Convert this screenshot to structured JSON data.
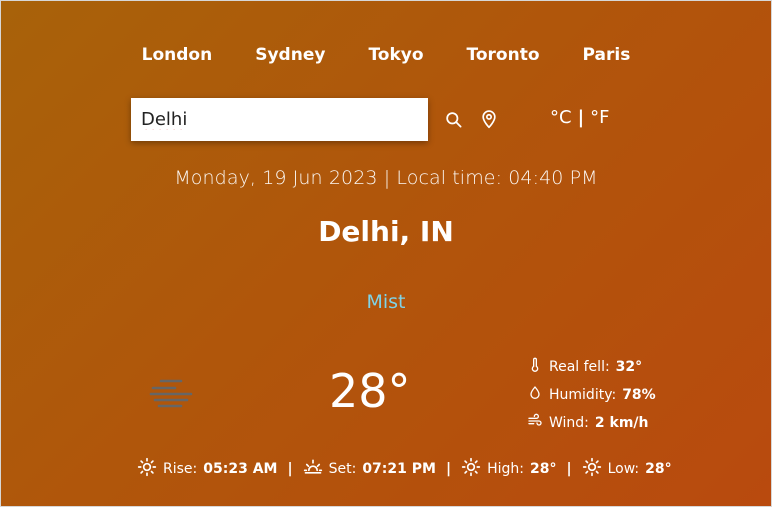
{
  "cities": [
    "London",
    "Sydney",
    "Tokyo",
    "Toronto",
    "Paris"
  ],
  "search": {
    "value": "Delhi"
  },
  "units": {
    "celsius": "°C",
    "separator": "|",
    "fahrenheit": "°F"
  },
  "datetime": "Monday, 19 Jun 2023 | Local time: 04:40 PM",
  "location": "Delhi, IN",
  "condition": "Mist",
  "temperature": "28°",
  "details": {
    "real_feel_label": "Real fell:",
    "real_feel_value": "32°",
    "humidity_label": "Humidity:",
    "humidity_value": "78%",
    "wind_label": "Wind:",
    "wind_value": "2 km/h"
  },
  "sun": {
    "rise_label": "Rise:",
    "rise_value": "05:23 AM",
    "set_label": "Set:",
    "set_value": "07:21 PM",
    "high_label": "High:",
    "high_value": "28°",
    "low_label": "Low:",
    "low_value": "28°",
    "separator": "|"
  },
  "colors": {
    "accent": "#7fd3e8",
    "bg_start": "#a8620a",
    "bg_end": "#b94a0e"
  },
  "icons": [
    "search-icon",
    "location-pin-icon",
    "mist-icon",
    "thermometer-icon",
    "droplet-icon",
    "wind-icon",
    "sunrise-icon",
    "sunset-icon",
    "sun-icon"
  ]
}
